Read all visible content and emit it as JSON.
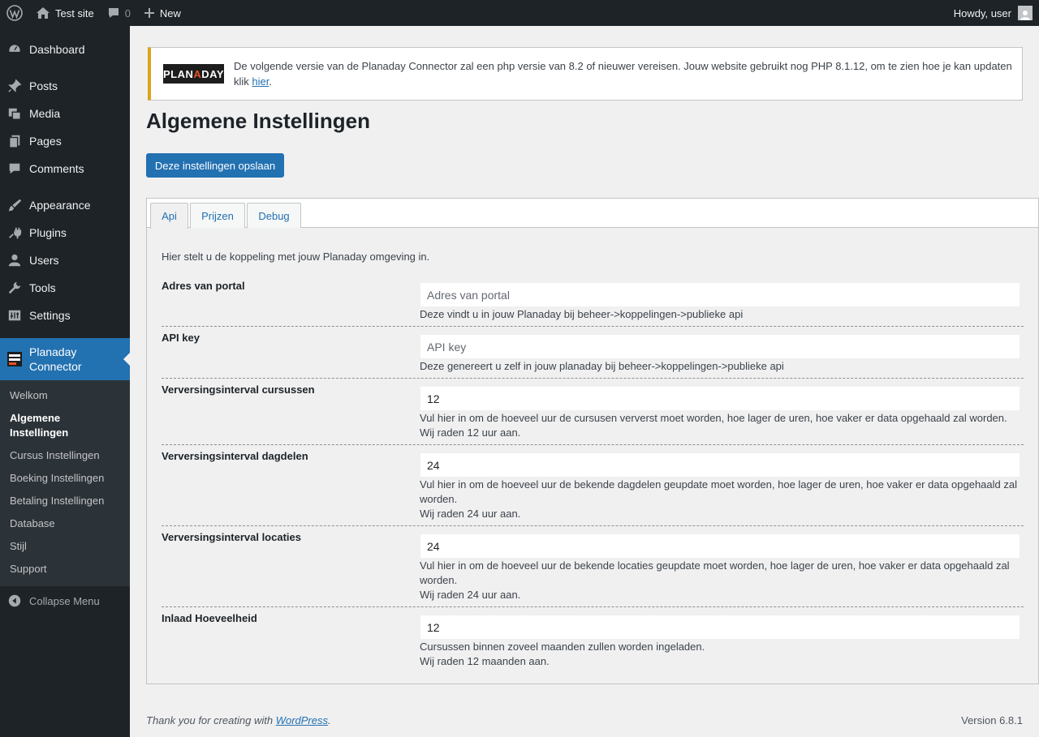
{
  "adminbar": {
    "site_name": "Test site",
    "comments_count": "0",
    "new_label": "New",
    "howdy": "Howdy, user"
  },
  "sidebar": {
    "items": [
      {
        "label": "Dashboard",
        "icon": "dashboard-icon"
      },
      {
        "label": "Posts",
        "icon": "pin-icon"
      },
      {
        "label": "Media",
        "icon": "media-icon"
      },
      {
        "label": "Pages",
        "icon": "pages-icon"
      },
      {
        "label": "Comments",
        "icon": "comment-icon"
      },
      {
        "label": "Appearance",
        "icon": "brush-icon"
      },
      {
        "label": "Plugins",
        "icon": "plug-icon"
      },
      {
        "label": "Users",
        "icon": "user-icon"
      },
      {
        "label": "Tools",
        "icon": "wrench-icon"
      },
      {
        "label": "Settings",
        "icon": "settings-icon"
      }
    ],
    "current": {
      "label_line1": "Planaday",
      "label_line2": "Connector"
    },
    "submenu": [
      {
        "label": "Welkom"
      },
      {
        "label": "Algemene Instellingen",
        "line1": "Algemene",
        "line2": "Instellingen"
      },
      {
        "label": "Cursus Instellingen"
      },
      {
        "label": "Boeking Instellingen"
      },
      {
        "label": "Betaling Instellingen"
      },
      {
        "label": "Database"
      },
      {
        "label": "Stijl"
      },
      {
        "label": "Support"
      }
    ],
    "collapse": "Collapse Menu"
  },
  "notice": {
    "logo_left": "PLAN",
    "logo_a": "A",
    "logo_right": "DAY",
    "text": "De volgende versie van de Planaday Connector zal een php versie van 8.2 of nieuwer vereisen. Jouw website gebruikt nog PHP 8.1.12, om te zien hoe je kan updaten klik ",
    "link": "hier",
    "end": "."
  },
  "page": {
    "title": "Algemene Instellingen",
    "save_label": "Deze instellingen opslaan"
  },
  "tabs": [
    {
      "label": "Api"
    },
    {
      "label": "Prijzen"
    },
    {
      "label": "Debug"
    }
  ],
  "intro": "Hier stelt u de koppeling met jouw Planaday omgeving in.",
  "fields": [
    {
      "label": "Adres van portal",
      "value": "",
      "placeholder": "Adres van portal",
      "desc1": "Deze vindt u in jouw Planaday bij beheer->koppelingen->publieke api",
      "desc2": ""
    },
    {
      "label": "API key",
      "value": "",
      "placeholder": "API key",
      "desc1": "Deze genereert u zelf in jouw planaday bij beheer->koppelingen->publieke api",
      "desc2": ""
    },
    {
      "label": "Verversingsinterval cursussen",
      "value": "12",
      "placeholder": "",
      "desc1": "Vul hier in om de hoeveel uur de cursusen ververst moet worden, hoe lager de uren, hoe vaker er data opgehaald zal worden.",
      "desc2": "Wij raden 12 uur aan."
    },
    {
      "label": "Verversingsinterval dagdelen",
      "value": "24",
      "placeholder": "",
      "desc1": "Vul hier in om de hoeveel uur de bekende dagdelen geupdate moet worden, hoe lager de uren, hoe vaker er data opgehaald zal worden.",
      "desc2": "Wij raden 24 uur aan."
    },
    {
      "label": "Verversingsinterval locaties",
      "value": "24",
      "placeholder": "",
      "desc1": "Vul hier in om de hoeveel uur de bekende locaties geupdate moet worden, hoe lager de uren, hoe vaker er data opgehaald zal worden.",
      "desc2": "Wij raden 24 uur aan."
    },
    {
      "label": "Inlaad Hoeveelheid",
      "value": "12",
      "placeholder": "",
      "desc1": "Cursussen binnen zoveel maanden zullen worden ingeladen.",
      "desc2": "Wij raden 12 maanden aan."
    }
  ],
  "footer": {
    "thanks": "Thank you for creating with ",
    "link": "WordPress",
    "end": ".",
    "version": "Version 6.8.1"
  }
}
